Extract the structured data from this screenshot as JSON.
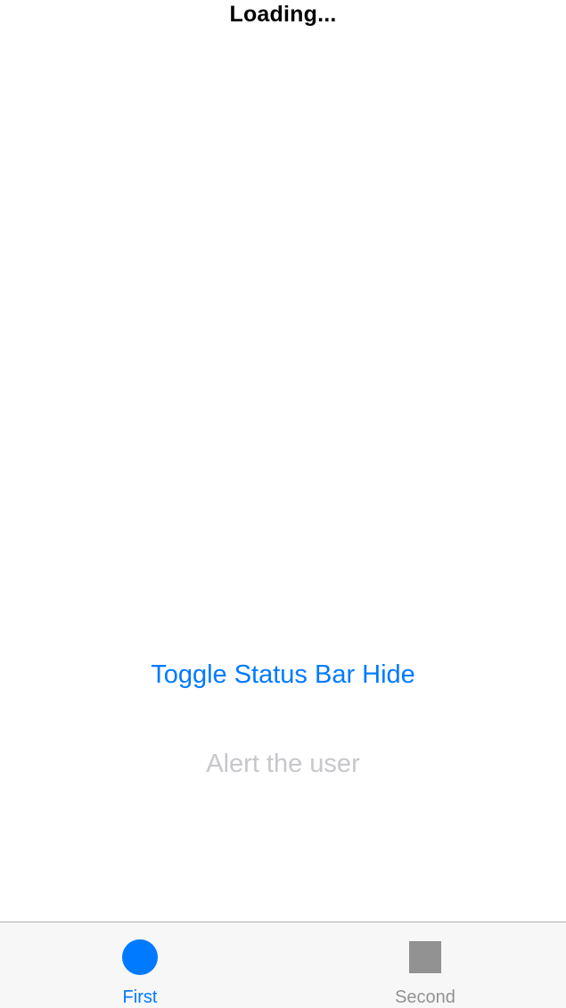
{
  "status_bar": {
    "title": "Loading..."
  },
  "main": {
    "toggle_button_label": "Toggle Status Bar Hide",
    "alert_button_label": "Alert the user"
  },
  "tab_bar": {
    "items": [
      {
        "label": "First",
        "icon": "circle-icon",
        "selected": true,
        "color": "#007aff"
      },
      {
        "label": "Second",
        "icon": "square-icon",
        "selected": false,
        "color": "#929292"
      }
    ]
  },
  "colors": {
    "accent": "#007aff",
    "disabled_text": "#c7c7cc",
    "tab_inactive": "#929292",
    "tab_bar_background": "#f7f7f7"
  }
}
